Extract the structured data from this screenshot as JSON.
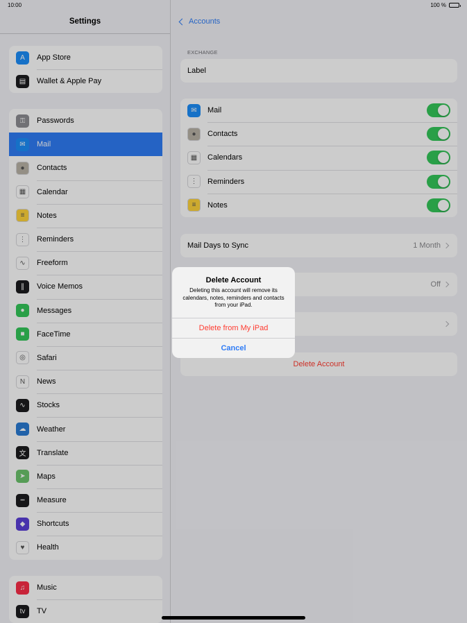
{
  "status_bar": {
    "time": "10:00",
    "battery": "100 %"
  },
  "sidebar": {
    "title": "Settings",
    "group1": [
      {
        "label": "App Store",
        "icon": "app-store-icon",
        "color": "#1c8ef9",
        "glyph": "A"
      },
      {
        "label": "Wallet & Apple Pay",
        "icon": "wallet-icon",
        "color": "#1c1c1e",
        "glyph": "▤"
      }
    ],
    "group2": [
      {
        "label": "Passwords",
        "icon": "key-icon",
        "color": "#8e8e93",
        "glyph": "⚿"
      },
      {
        "label": "Mail",
        "icon": "mail-icon",
        "color": "#1c8ef9",
        "glyph": "✉",
        "selected": true
      },
      {
        "label": "Contacts",
        "icon": "contacts-icon",
        "color": "#b9b3a7",
        "glyph": "●"
      },
      {
        "label": "Calendar",
        "icon": "calendar-icon",
        "color": "#ffffff",
        "glyph": "▦"
      },
      {
        "label": "Notes",
        "icon": "notes-icon",
        "color": "#ffd43b",
        "glyph": "≡"
      },
      {
        "label": "Reminders",
        "icon": "reminders-icon",
        "color": "#ffffff",
        "glyph": "⋮"
      },
      {
        "label": "Freeform",
        "icon": "freeform-icon",
        "color": "#ffffff",
        "glyph": "∿"
      },
      {
        "label": "Voice Memos",
        "icon": "voice-memos-icon",
        "color": "#1c1c1e",
        "glyph": "∥"
      },
      {
        "label": "Messages",
        "icon": "messages-icon",
        "color": "#34c759",
        "glyph": "●"
      },
      {
        "label": "FaceTime",
        "icon": "facetime-icon",
        "color": "#34c759",
        "glyph": "■"
      },
      {
        "label": "Safari",
        "icon": "safari-icon",
        "color": "#ffffff",
        "glyph": "◎"
      },
      {
        "label": "News",
        "icon": "news-icon",
        "color": "#ffffff",
        "glyph": "N"
      },
      {
        "label": "Stocks",
        "icon": "stocks-icon",
        "color": "#1c1c1e",
        "glyph": "∿"
      },
      {
        "label": "Weather",
        "icon": "weather-icon",
        "color": "#2a7bd4",
        "glyph": "☁"
      },
      {
        "label": "Translate",
        "icon": "translate-icon",
        "color": "#1c1c1e",
        "glyph": "文"
      },
      {
        "label": "Maps",
        "icon": "maps-icon",
        "color": "#6cc46c",
        "glyph": "➤"
      },
      {
        "label": "Measure",
        "icon": "measure-icon",
        "color": "#1c1c1e",
        "glyph": "┅"
      },
      {
        "label": "Shortcuts",
        "icon": "shortcuts-icon",
        "color": "#5b3fd8",
        "glyph": "◆"
      },
      {
        "label": "Health",
        "icon": "health-icon",
        "color": "#ffffff",
        "glyph": "♥"
      }
    ],
    "group3": [
      {
        "label": "Music",
        "icon": "music-icon",
        "color": "#fa2d48",
        "glyph": "♫"
      },
      {
        "label": "TV",
        "icon": "tv-icon",
        "color": "#1c1c1e",
        "glyph": "tv"
      }
    ]
  },
  "main": {
    "back_label": "Accounts",
    "section_header": "EXCHANGE",
    "label_row": "Label",
    "sync_items": [
      {
        "label": "Mail",
        "icon": "mail-icon",
        "color": "#1c8ef9",
        "glyph": "✉",
        "on": true
      },
      {
        "label": "Contacts",
        "icon": "contacts-icon",
        "color": "#b9b3a7",
        "glyph": "●",
        "on": true
      },
      {
        "label": "Calendars",
        "icon": "calendar-icon",
        "color": "#ffffff",
        "glyph": "▦",
        "on": true
      },
      {
        "label": "Reminders",
        "icon": "reminders-icon",
        "color": "#ffffff",
        "glyph": "⋮",
        "on": true
      },
      {
        "label": "Notes",
        "icon": "notes-icon",
        "color": "#ffd43b",
        "glyph": "≡",
        "on": true
      }
    ],
    "mail_days": {
      "label": "Mail Days to Sync",
      "value": "1 Month"
    },
    "auto_reply": {
      "value": "Off"
    },
    "delete_account": "Delete Account"
  },
  "alert": {
    "title": "Delete Account",
    "message": "Deleting this account will remove its calendars, notes, reminders and contacts from your iPad.",
    "destructive_label": "Delete from My iPad",
    "cancel_label": "Cancel"
  },
  "colors": {
    "accent": "#2f7cf6",
    "destructive": "#ff3b30",
    "toggle_on": "#34c759"
  }
}
